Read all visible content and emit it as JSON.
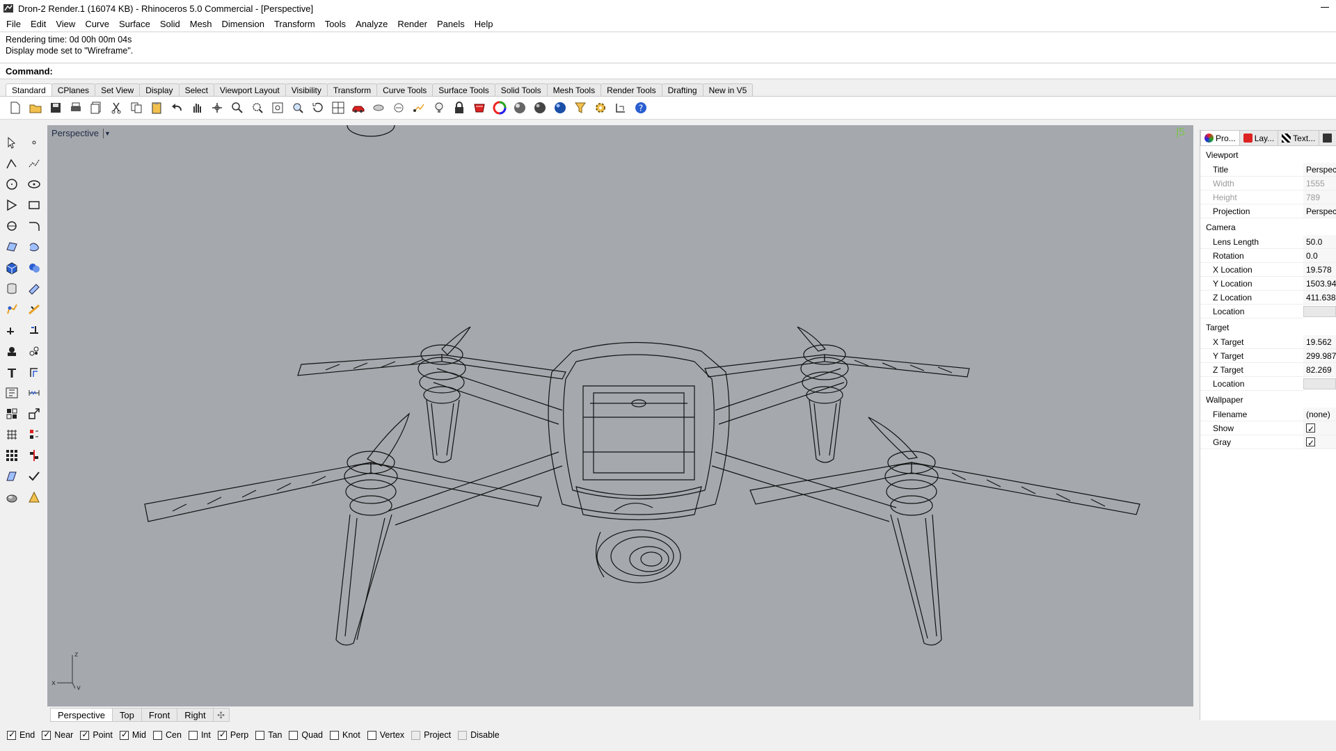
{
  "window": {
    "title": "Dron-2 Render.1 (16074 KB) - Rhinoceros 5.0 Commercial - [Perspective]"
  },
  "menu": [
    "File",
    "Edit",
    "View",
    "Curve",
    "Surface",
    "Solid",
    "Mesh",
    "Dimension",
    "Transform",
    "Tools",
    "Analyze",
    "Render",
    "Panels",
    "Help"
  ],
  "command_history": [
    "Rendering time: 0d 00h 00m 04s",
    "Display mode set to \"Wireframe\"."
  ],
  "command": {
    "label": "Command:",
    "value": ""
  },
  "toolbar_tabs": [
    "Standard",
    "CPlanes",
    "Set View",
    "Display",
    "Select",
    "Viewport Layout",
    "Visibility",
    "Transform",
    "Curve Tools",
    "Surface Tools",
    "Solid Tools",
    "Mesh Tools",
    "Render Tools",
    "Drafting",
    "New in V5"
  ],
  "toolbar_icons": [
    "new-file-icon",
    "open-file-icon",
    "save-icon",
    "print-icon",
    "export-icon",
    "cut-icon",
    "copy-icon",
    "paste-icon",
    "undo-icon",
    "pan-hand-icon",
    "rotate-view-icon",
    "zoom-icon",
    "zoom-window-icon",
    "zoom-extents-icon",
    "zoom-selected-icon",
    "undo-view-icon",
    "viewport-layout-icon",
    "car-icon",
    "hide-icon",
    "show-icon",
    "select-icon",
    "light-bulb-icon",
    "lock-icon",
    "layer-icon",
    "color-wheel-icon",
    "render-sphere-icon",
    "shaded-sphere-icon",
    "material-sphere-icon",
    "filter-icon",
    "gear-icon",
    "dimension-icon",
    "help-icon"
  ],
  "left_tools": [
    "select-arrow-icon",
    "point-icon",
    "polyline-icon",
    "curve-edit-icon",
    "circle-icon",
    "ellipse-icon",
    "polygon-icon",
    "rectangle-icon",
    "arc-icon",
    "fillet-icon",
    "surface-icon",
    "loft-icon",
    "box-solid-icon",
    "boolean-icon",
    "cylinder-icon",
    "extrude-icon",
    "sweep-icon",
    "blend-icon",
    "trim-icon",
    "split-icon",
    "group-icon",
    "explode-icon",
    "join-icon",
    "offset-icon",
    "text-icon",
    "dimension-icon",
    "block-icon",
    "scale-icon",
    "mesh-icon",
    "array-icon",
    "matrix-icon",
    "align-icon",
    "analyze-icon",
    "check-icon",
    "shade-icon",
    "render-icon"
  ],
  "viewport": {
    "title": "Perspective",
    "hint": "|5",
    "axis": {
      "x": "x",
      "y": "y",
      "z": "z"
    }
  },
  "viewport_tabs": [
    "Perspective",
    "Top",
    "Front",
    "Right"
  ],
  "osnaps": [
    {
      "label": "End",
      "checked": true
    },
    {
      "label": "Near",
      "checked": true
    },
    {
      "label": "Point",
      "checked": true
    },
    {
      "label": "Mid",
      "checked": true
    },
    {
      "label": "Cen",
      "checked": false
    },
    {
      "label": "Int",
      "checked": false
    },
    {
      "label": "Perp",
      "checked": true
    },
    {
      "label": "Tan",
      "checked": false
    },
    {
      "label": "Quad",
      "checked": false
    },
    {
      "label": "Knot",
      "checked": false
    },
    {
      "label": "Vertex",
      "checked": false
    },
    {
      "label": "Project",
      "checked": false,
      "disabled": true
    },
    {
      "label": "Disable",
      "checked": false,
      "disabled": true
    }
  ],
  "panel": {
    "tabs": [
      "Pro...",
      "Lay...",
      "Text..."
    ],
    "sections": [
      {
        "title": "Viewport",
        "rows": [
          {
            "key": "Title",
            "value": "Perspec"
          },
          {
            "key": "Width",
            "value": "1555",
            "disabled": true
          },
          {
            "key": "Height",
            "value": "789",
            "disabled": true
          },
          {
            "key": "Projection",
            "value": "Perspec"
          }
        ]
      },
      {
        "title": "Camera",
        "rows": [
          {
            "key": "Lens Length",
            "value": "50.0"
          },
          {
            "key": "Rotation",
            "value": "0.0"
          },
          {
            "key": "X Location",
            "value": "19.578"
          },
          {
            "key": "Y Location",
            "value": "1503.94"
          },
          {
            "key": "Z Location",
            "value": "411.638"
          },
          {
            "key": "Location",
            "value": "",
            "box": true
          }
        ]
      },
      {
        "title": "Target",
        "rows": [
          {
            "key": "X Target",
            "value": "19.562"
          },
          {
            "key": "Y Target",
            "value": "299.987"
          },
          {
            "key": "Z Target",
            "value": "82.269"
          },
          {
            "key": "Location",
            "value": "",
            "box": true
          }
        ]
      },
      {
        "title": "Wallpaper",
        "rows": [
          {
            "key": "Filename",
            "value": "(none)"
          },
          {
            "key": "Show",
            "check": true
          },
          {
            "key": "Gray",
            "check": true
          }
        ]
      }
    ]
  }
}
